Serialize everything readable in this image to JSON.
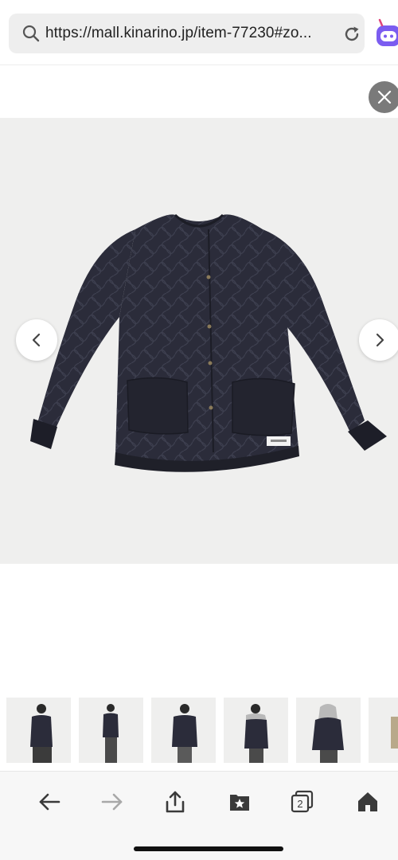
{
  "browser": {
    "url": "https://mall.kinarino.jp/item-77230#zo...",
    "tab_count": "2"
  },
  "icons": {
    "search": "search-icon",
    "reload": "reload-icon",
    "extension": "extension-icon",
    "close": "close-icon",
    "prev": "chevron-left-icon",
    "next": "chevron-right-icon",
    "back": "arrow-left-icon",
    "forward": "arrow-right-icon",
    "share": "share-icon",
    "bookmarks": "bookmark-star-icon",
    "tabs": "tabs-icon",
    "home": "home-icon"
  },
  "gallery": {
    "thumbnail_count": 6
  },
  "colors": {
    "jacket": "#2b2c3a",
    "background": "#efefee",
    "toolbar_icon": "#3a3a3a",
    "disabled_icon": "#a8a8a8",
    "extension_accent": "#7b5cf0"
  }
}
